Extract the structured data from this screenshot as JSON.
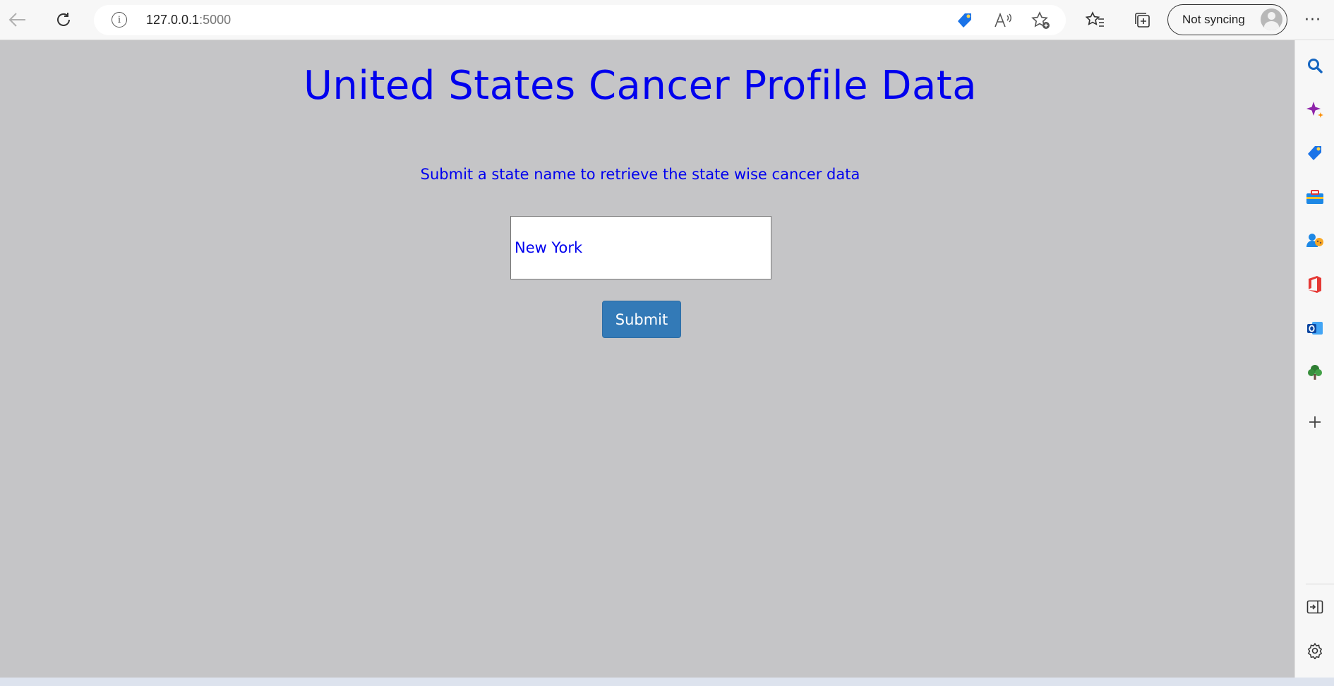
{
  "browser": {
    "url_host": "127.0.0.1",
    "url_port": ":5000",
    "sync_label": "Not syncing",
    "icons": {
      "back": "back-arrow-icon",
      "refresh": "refresh-icon",
      "info": "info-icon",
      "coupon": "shopping-tag-icon",
      "read_aloud": "read-aloud-icon",
      "add_favorite": "add-favorite-icon",
      "favorites": "favorites-icon",
      "collections": "collections-icon",
      "more": "more-icon"
    }
  },
  "page": {
    "title": "United States Cancer Profile Data",
    "instructions": "Submit a state name to retrieve the state wise cancer data",
    "state_input_value": "New York",
    "submit_label": "Submit",
    "background_color": "#c5c5c7",
    "text_color": "#0000ee",
    "button_color": "#337ab7"
  },
  "sidebar": {
    "icons": [
      "search-icon",
      "copilot-icon",
      "shopping-icon",
      "tools-icon",
      "games-icon",
      "office-icon",
      "outlook-icon",
      "tree-icon",
      "add-icon",
      "split-screen-icon",
      "settings-icon"
    ]
  }
}
